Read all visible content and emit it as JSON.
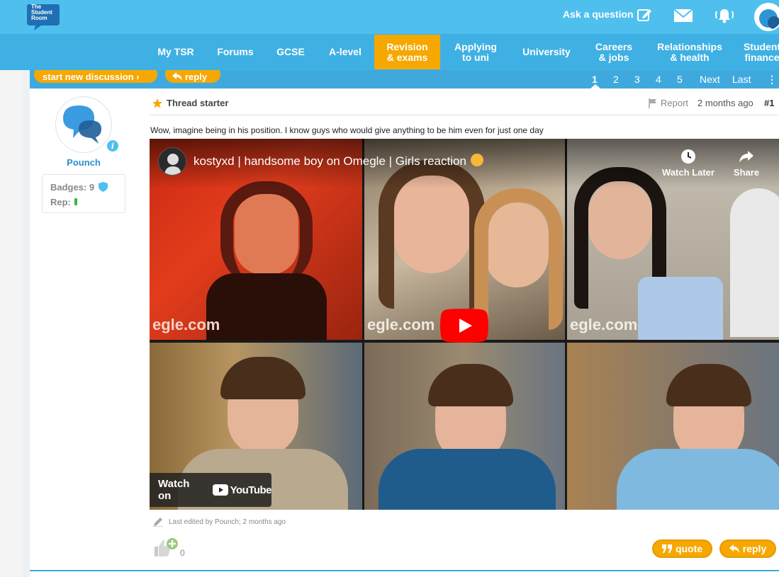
{
  "brand": {
    "logo_text": "The Student Room"
  },
  "header": {
    "ask_label": "Ask a question"
  },
  "nav": {
    "items": [
      {
        "label": "My TSR"
      },
      {
        "label": "Forums"
      },
      {
        "label": "GCSE"
      },
      {
        "label": "A-level"
      },
      {
        "label": "Revision & exams"
      },
      {
        "label": "Applying to uni"
      },
      {
        "label": "University"
      },
      {
        "label": "Careers & jobs"
      },
      {
        "label": "Relationships & health"
      },
      {
        "label": "Student finance"
      }
    ],
    "active": "Revision & exams"
  },
  "toolbar": {
    "new_discussion_label": "start new discussion ›",
    "reply_label": "reply",
    "pages": [
      "1",
      "2",
      "3",
      "4",
      "5"
    ],
    "current_page": "1",
    "next_label": "Next",
    "last_label": "Last"
  },
  "author": {
    "name": "Pounch",
    "badges_label": "Badges: 9",
    "rep_label": "Rep:"
  },
  "post": {
    "starter_label": "Thread starter",
    "report_label": "Report",
    "time": "2 months ago",
    "number": "#1",
    "text": "Wow, imagine being in his position. I know guys who would give anything to be him even for just one day",
    "edited": "Last edited by Pounch; 2 months ago",
    "like_count": "0",
    "quote_label": "quote",
    "reply_label": "reply"
  },
  "video": {
    "title": "kostyxd | handsome boy on Omegle | Girls reaction",
    "watch_later": "Watch Later",
    "share": "Share",
    "watch_on": "Watch on",
    "yt_name": "YouTube",
    "cell_watermark": "egle.com"
  },
  "colors": {
    "topbar": "#4fc0ee",
    "navbar": "#3fb0e3",
    "accent_orange": "#f6a800",
    "toolbar": "#3fa9de",
    "link_blue": "#2b8fcf",
    "youtube_red": "#ff0000"
  }
}
